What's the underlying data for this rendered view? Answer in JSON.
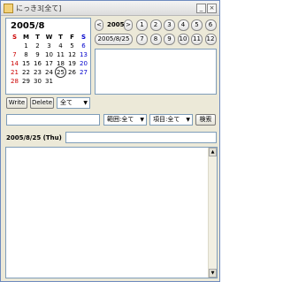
{
  "window": {
    "title": "にっき3[全て]",
    "minimize": "_",
    "close": "×"
  },
  "calendar": {
    "title": "2005/8",
    "weekdays": [
      "S",
      "M",
      "T",
      "W",
      "T",
      "F",
      "S"
    ],
    "weeks": [
      [
        "",
        "1",
        "2",
        "3",
        "4",
        "5",
        "6"
      ],
      [
        "7",
        "8",
        "9",
        "10",
        "11",
        "12",
        "13"
      ],
      [
        "14",
        "15",
        "16",
        "17",
        "18",
        "19",
        "20"
      ],
      [
        "21",
        "22",
        "23",
        "24",
        "25",
        "26",
        "27"
      ],
      [
        "28",
        "29",
        "30",
        "31",
        "",
        "",
        ""
      ]
    ],
    "today": "25"
  },
  "nav": {
    "prev": "<",
    "year": "2005",
    "next": ">",
    "date": "2005/8/25",
    "months": [
      "1",
      "2",
      "3",
      "4",
      "5",
      "6",
      "7",
      "8",
      "9",
      "10",
      "11",
      "12"
    ]
  },
  "toolbar": {
    "write": "Write",
    "delete": "Delete",
    "filter": "全て"
  },
  "search": {
    "range": "範囲:全て",
    "item": "項目:全て",
    "button": "検索"
  },
  "entry": {
    "date": "2005/8/25 (Thu)"
  },
  "icons": {
    "app": "notebook-icon",
    "dropdown": "▼"
  }
}
